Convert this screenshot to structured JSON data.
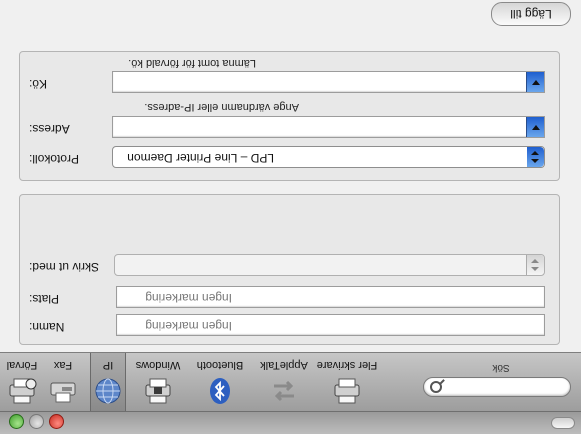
{
  "toolbar": {
    "items": [
      {
        "label": "Förval",
        "icon": "printer-icon"
      },
      {
        "label": "Fax",
        "icon": "fax-icon"
      },
      {
        "label": "IP",
        "icon": "globe-icon"
      },
      {
        "label": "Windows",
        "icon": "windows-printer-icon"
      },
      {
        "label": "Bluetooth",
        "icon": "bluetooth-icon"
      },
      {
        "label": "AppleTalk",
        "icon": "appletalk-icon"
      },
      {
        "label": "Fler skrivare",
        "icon": "printer-icon"
      }
    ],
    "selected": "IP",
    "search_label": "Sök",
    "search_value": ""
  },
  "connection": {
    "protocol_label": "Protokoll:",
    "protocol_value": "LPD – Line Printer Daemon",
    "address_label": "Adress:",
    "address_value": "",
    "address_hint": "Ange värdnamn eller IP-adress.",
    "queue_label": "Kö:",
    "queue_value": "",
    "queue_hint": "Lämna tomt för förvald kö."
  },
  "details": {
    "name_label": "Namn:",
    "name_value": "Ingen markering",
    "location_label": "Plats:",
    "location_value": "Ingen markering",
    "print_using_label": "Skriv ut med:",
    "print_using_value": ""
  },
  "actions": {
    "add_label": "Lägg till"
  },
  "colors": {
    "accent": "#3b7fe0",
    "close": "#d9382c",
    "zoom": "#4fb13a"
  }
}
